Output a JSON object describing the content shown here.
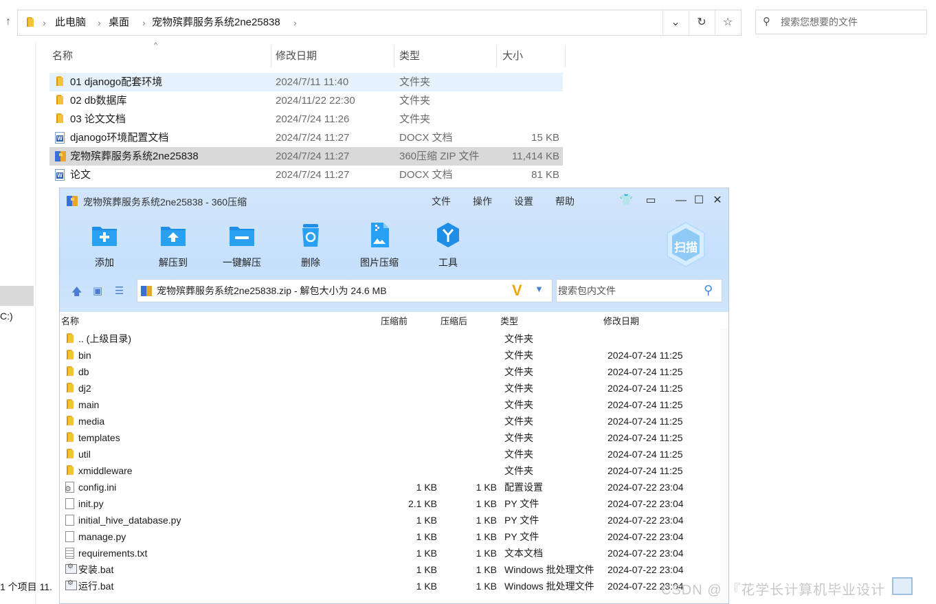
{
  "explorer": {
    "breadcrumb": [
      "此电脑",
      "桌面",
      "宠物殡葬服务系统2ne25838"
    ],
    "search_placeholder": "搜索您想要的文件",
    "columns": {
      "name": "名称",
      "date": "修改日期",
      "type": "类型",
      "size": "大小"
    },
    "files": [
      {
        "name": "01 djanogo配套环境",
        "date": "2024/7/11 11:40",
        "type": "文件夹",
        "size": "",
        "icon": "folder-icon"
      },
      {
        "name": "02 db数据库",
        "date": "2024/11/22 22:30",
        "type": "文件夹",
        "size": "",
        "icon": "folder-icon"
      },
      {
        "name": "03 论文文档",
        "date": "2024/7/24 11:26",
        "type": "文件夹",
        "size": "",
        "icon": "folder-icon"
      },
      {
        "name": "djanogo环境配置文档",
        "date": "2024/7/24 11:27",
        "type": "DOCX 文档",
        "size": "15 KB",
        "icon": "docx-icon"
      },
      {
        "name": "宠物殡葬服务系统2ne25838",
        "date": "2024/7/24 11:27",
        "type": "360压缩 ZIP 文件",
        "size": "11,414 KB",
        "icon": "zip-icon"
      },
      {
        "name": "论文",
        "date": "2024/7/24 11:27",
        "type": "DOCX 文档",
        "size": "81 KB",
        "icon": "docx-icon"
      }
    ],
    "nav_drive": "C:)",
    "status_text": "1 个项目   11."
  },
  "zip": {
    "title": "宠物殡葬服务系统2ne25838 - 360压缩",
    "menu": [
      "文件",
      "操作",
      "设置",
      "帮助"
    ],
    "toolbar": [
      {
        "label": "添加",
        "icon": "add-icon"
      },
      {
        "label": "解压到",
        "icon": "extract-to-icon"
      },
      {
        "label": "一键解压",
        "icon": "one-click-extract-icon"
      },
      {
        "label": "删除",
        "icon": "delete-icon"
      },
      {
        "label": "图片压缩",
        "icon": "image-compress-icon"
      },
      {
        "label": "工具",
        "icon": "tools-icon"
      }
    ],
    "scan_label": "扫描",
    "path": "宠物殡葬服务系统2ne25838.zip - 解包大小为 24.6 MB",
    "search_placeholder": "搜索包内文件",
    "columns": {
      "name": "名称",
      "before": "压缩前",
      "after": "压缩后",
      "type": "类型",
      "date": "修改日期"
    },
    "files": [
      {
        "name": ".. (上级目录)",
        "before": "",
        "after": "",
        "type": "文件夹",
        "date": "",
        "icon": "folder-icon"
      },
      {
        "name": "bin",
        "before": "",
        "after": "",
        "type": "文件夹",
        "date": "2024-07-24 11:25",
        "icon": "folder-icon"
      },
      {
        "name": "db",
        "before": "",
        "after": "",
        "type": "文件夹",
        "date": "2024-07-24 11:25",
        "icon": "folder-icon"
      },
      {
        "name": "dj2",
        "before": "",
        "after": "",
        "type": "文件夹",
        "date": "2024-07-24 11:25",
        "icon": "folder-icon"
      },
      {
        "name": "main",
        "before": "",
        "after": "",
        "type": "文件夹",
        "date": "2024-07-24 11:25",
        "icon": "folder-icon"
      },
      {
        "name": "media",
        "before": "",
        "after": "",
        "type": "文件夹",
        "date": "2024-07-24 11:25",
        "icon": "folder-icon"
      },
      {
        "name": "templates",
        "before": "",
        "after": "",
        "type": "文件夹",
        "date": "2024-07-24 11:25",
        "icon": "folder-icon"
      },
      {
        "name": "util",
        "before": "",
        "after": "",
        "type": "文件夹",
        "date": "2024-07-24 11:25",
        "icon": "folder-icon"
      },
      {
        "name": "xmiddleware",
        "before": "",
        "after": "",
        "type": "文件夹",
        "date": "2024-07-24 11:25",
        "icon": "folder-icon"
      },
      {
        "name": "config.ini",
        "before": "1 KB",
        "after": "1 KB",
        "type": "配置设置",
        "date": "2024-07-22 23:04",
        "icon": "config-file-icon"
      },
      {
        "name": "init.py",
        "before": "2.1 KB",
        "after": "1 KB",
        "type": "PY 文件",
        "date": "2024-07-22 23:04",
        "icon": "file-icon"
      },
      {
        "name": "initial_hive_database.py",
        "before": "1 KB",
        "after": "1 KB",
        "type": "PY 文件",
        "date": "2024-07-22 23:04",
        "icon": "file-icon"
      },
      {
        "name": "manage.py",
        "before": "1 KB",
        "after": "1 KB",
        "type": "PY 文件",
        "date": "2024-07-22 23:04",
        "icon": "file-icon"
      },
      {
        "name": "requirements.txt",
        "before": "1 KB",
        "after": "1 KB",
        "type": "文本文档",
        "date": "2024-07-22 23:04",
        "icon": "text-file-icon"
      },
      {
        "name": "安装.bat",
        "before": "1 KB",
        "after": "1 KB",
        "type": "Windows 批处理文件",
        "date": "2024-07-22 23:04",
        "icon": "batch-file-icon"
      },
      {
        "name": "运行.bat",
        "before": "1 KB",
        "after": "1 KB",
        "type": "Windows 批处理文件",
        "date": "2024-07-22 23:04",
        "icon": "batch-file-icon"
      }
    ]
  },
  "watermark": "CSDN @ 『花学长计算机毕业设计"
}
